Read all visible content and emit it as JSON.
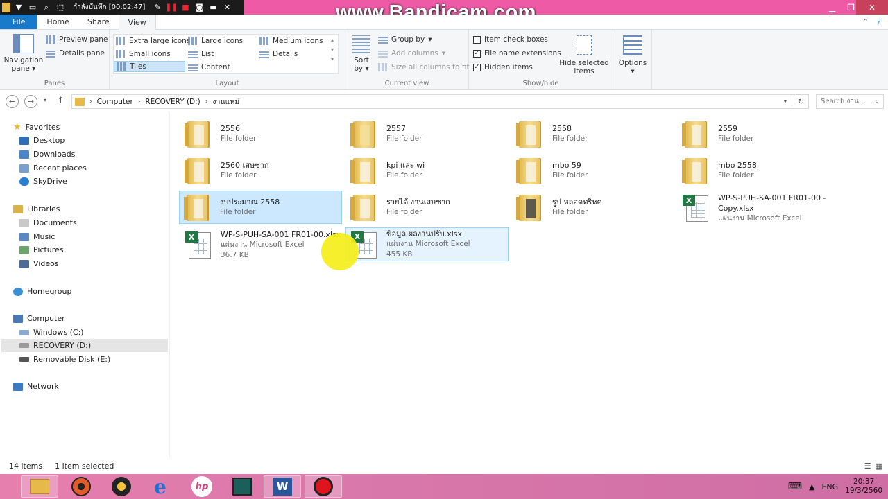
{
  "recorder": {
    "title": "กำลังบันทึก [00:02:47]",
    "watermark": "www.Bandicam.com",
    "window_title_fragment": "งาน"
  },
  "ribbon_tabs": {
    "file": "File",
    "home": "Home",
    "share": "Share",
    "view": "View"
  },
  "ribbon": {
    "panes": {
      "navigation_pane": "Navigation",
      "navigation_pane2": "pane",
      "preview_pane": "Preview pane",
      "details_pane": "Details pane",
      "label": "Panes"
    },
    "layout": {
      "extra_large_icons": "Extra large icons",
      "large_icons": "Large icons",
      "medium_icons": "Medium icons",
      "small_icons": "Small icons",
      "list": "List",
      "details": "Details",
      "tiles": "Tiles",
      "content": "Content",
      "label": "Layout"
    },
    "current_view": {
      "sort_by": "Sort",
      "sort_by2": "by",
      "group_by": "Group by",
      "add_columns": "Add columns",
      "size_all_columns": "Size all columns to fit",
      "label": "Current view"
    },
    "show_hide": {
      "item_check_boxes": "Item check boxes",
      "file_name_extensions": "File name extensions",
      "hidden_items": "Hidden items",
      "hide_selected": "Hide selected",
      "hide_selected2": "items",
      "label": "Show/hide",
      "item_check_boxes_checked": false,
      "file_name_extensions_checked": true,
      "hidden_items_checked": true
    },
    "options": "Options"
  },
  "address": {
    "crumb1": "Computer",
    "crumb2": "RECOVERY (D:)",
    "crumb3": "งานแหม่",
    "search_placeholder": "Search งาน..."
  },
  "nav": {
    "favorites": "Favorites",
    "desktop": "Desktop",
    "downloads": "Downloads",
    "recent_places": "Recent places",
    "skydrive": "SkyDrive",
    "libraries": "Libraries",
    "documents": "Documents",
    "music": "Music",
    "pictures": "Pictures",
    "videos": "Videos",
    "homegroup": "Homegroup",
    "computer": "Computer",
    "windows_c": "Windows (C:)",
    "recovery_d": "RECOVERY (D:)",
    "removable_e": "Removable Disk (E:)",
    "network": "Network"
  },
  "items": [
    {
      "name": "2556",
      "sub": "File folder"
    },
    {
      "name": "2557",
      "sub": "File folder"
    },
    {
      "name": "2558",
      "sub": "File folder"
    },
    {
      "name": "2559",
      "sub": "File folder"
    },
    {
      "name": "2560 เสษซาก",
      "sub": "File folder"
    },
    {
      "name": "kpi และ wi",
      "sub": "File folder"
    },
    {
      "name": "mbo 59",
      "sub": "File folder"
    },
    {
      "name": "mbo 2558",
      "sub": "File folder"
    },
    {
      "name": "งบประมาณ 2558",
      "sub": "File folder"
    },
    {
      "name": "รายได้ งานเสษซาก",
      "sub": "File folder"
    },
    {
      "name": "รูป หลอดทริหด",
      "sub": "File folder"
    },
    {
      "name": "WP-S-PUH-SA-001 FR01-00 -",
      "name2": "Copy.xlsx",
      "sub": "แผ่นงาน Microsoft Excel"
    },
    {
      "name": "WP-S-PUH-SA-001 FR01-00.xlsx",
      "sub": "แผ่นงาน Microsoft Excel",
      "size": "36.7 KB"
    },
    {
      "name": "ข้อมูล ผลงานปรับ.xlsx",
      "sub": "แผ่นงาน Microsoft Excel",
      "size": "455 KB"
    }
  ],
  "status": {
    "count": "14 items",
    "selected": "1 item selected"
  },
  "taskbar": {
    "lang": "ENG",
    "time": "20:37",
    "date": "19/3/2560"
  }
}
